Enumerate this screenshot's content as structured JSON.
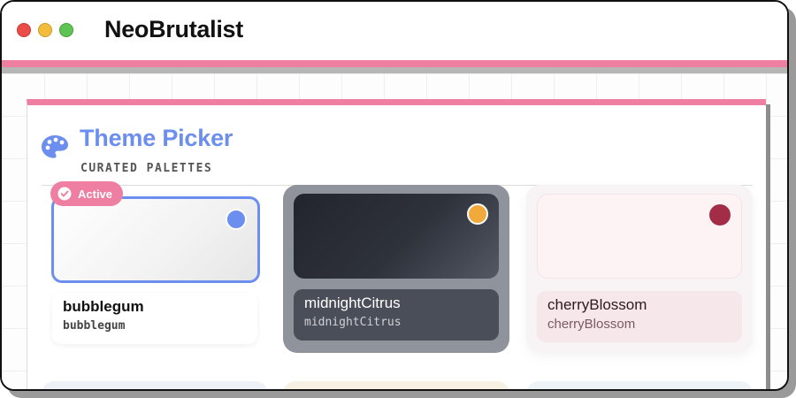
{
  "window": {
    "title": "NeoBrutalist",
    "controls": [
      "close",
      "minimize",
      "maximize"
    ]
  },
  "panel": {
    "icon": "palette-icon",
    "title": "Theme Picker",
    "subtitle": "CURATED PALETTES"
  },
  "themes": [
    {
      "name": "bubblegum",
      "code": "bubblegum",
      "badge": "Active",
      "dot_color": "#6c8eee",
      "selected": true
    },
    {
      "name": "midnightCitrus",
      "code": "midnightCitrus",
      "dot_color": "#f2a93b",
      "selected": false
    },
    {
      "name": "cherryBlossom",
      "code": "cherryBlossom",
      "dot_color": "#a32d47",
      "selected": false
    }
  ],
  "colors": {
    "accent_pink": "#ee7fa3",
    "accent_blue": "#6c8eee"
  }
}
